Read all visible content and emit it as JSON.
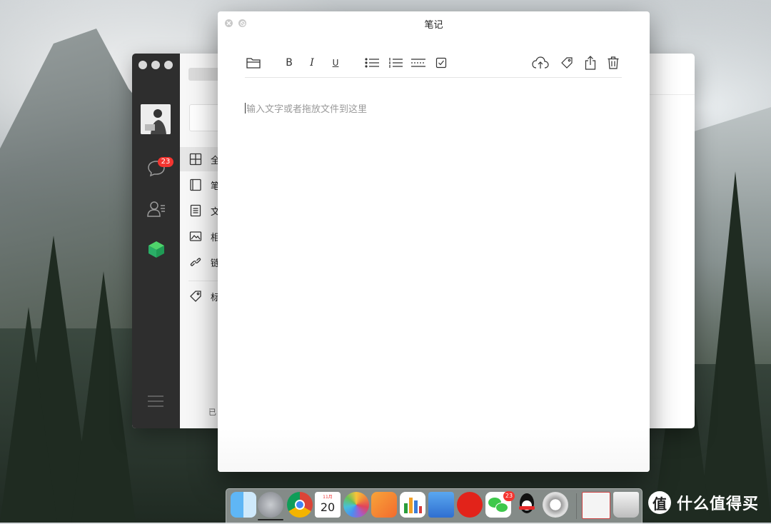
{
  "note_window": {
    "title": "笔记",
    "editor_placeholder": "输入文字或者拖放文件到这里",
    "toolbar": {
      "bold": "B",
      "italic": "I",
      "underline": "U"
    }
  },
  "back_window": {
    "badge_count": "23",
    "categories": [
      {
        "label": "全",
        "icon": "grid-icon",
        "selected": true
      },
      {
        "label": "笔",
        "icon": "notebook-icon",
        "selected": false
      },
      {
        "label": "文",
        "icon": "document-icon",
        "selected": false
      },
      {
        "label": "相",
        "icon": "image-icon",
        "selected": false
      },
      {
        "label": "链",
        "icon": "link-icon",
        "selected": false
      },
      {
        "label": "标",
        "icon": "tag-icon",
        "selected": false
      }
    ],
    "footer_text": "已"
  },
  "dock": {
    "calendar_month": "11月",
    "calendar_day": "20",
    "wechat_badge": "23",
    "items": [
      "finder",
      "launchpad",
      "chrome",
      "calendar",
      "photos",
      "pages",
      "numbers",
      "keynote",
      "netease-music",
      "wechat",
      "qq",
      "system-utilities",
      "preview",
      "trash"
    ]
  },
  "watermark": {
    "logo": "值",
    "text": "什么值得买"
  },
  "colors": {
    "badge_red": "#f43530",
    "sidebar_dark": "#2e2e2e",
    "accent_green": "#2aae67"
  }
}
